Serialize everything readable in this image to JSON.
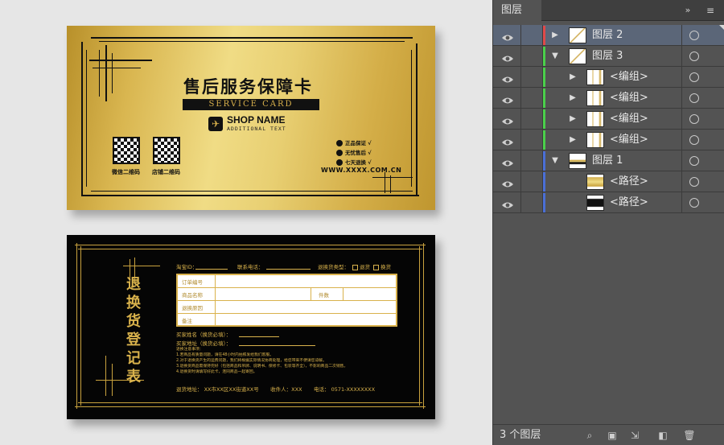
{
  "front_card": {
    "title": "售后服务保障卡",
    "subtitle": "SERVICE CARD",
    "shop_name": "SHOP NAME",
    "shop_sub": "ADDITIONAL TEXT",
    "qr1_label": "微信二维码",
    "qr2_label": "店铺二维码",
    "features": [
      "正品保证",
      "无忧售后",
      "七天退换"
    ],
    "url": "WWW.XXXX.COM.CN"
  },
  "back_card": {
    "vertical_title": "退换货登记表",
    "taobao_id": "淘宝ID：",
    "phone": "联系电话：",
    "return_type": "退换货类型：",
    "opt_return": "退货",
    "opt_exchange": "换货",
    "table_rows": [
      "订单编号",
      "商品名称",
      "退换原因",
      "备注"
    ],
    "table_qty": "件数",
    "buyer_name": "买家姓名（换货必填）：",
    "buyer_address": "买家地址（换货必填）：",
    "notes_title": "退换注意事项：",
    "notes": [
      "1.若商品有质量问题，请在48小时内拍照发给我们客服。",
      "2.对于退换货产生的运费问题，我们将根据实际情况协商处理，给您带来不便请您谅解。",
      "3.退换货商品需保持完好（包括商品和吊牌、说明书、保修卡、包装等齐全），不影响商品二次销售。",
      "4.退换货时请填写好此卡，连同商品一起寄回。"
    ],
    "footer_address": "退货地址：  XX市XX区XX街道XX号",
    "footer_receiver": "收件人：XXX",
    "footer_phone": "电话：  0571-XXXXXXXX"
  },
  "layers_panel": {
    "tab_title": "图层",
    "collapse_icon": "»",
    "menu_icon": "≡",
    "layers": [
      {
        "name": "图层 2",
        "indent": 0,
        "arrow": "▶",
        "color": "#e04a4a",
        "selected": true,
        "thumb": "white-gold"
      },
      {
        "name": "图层 3",
        "indent": 0,
        "arrow": "▼",
        "color": "#4ad04a",
        "selected": false,
        "thumb": "white-gold"
      },
      {
        "name": "<编组>",
        "indent": 1,
        "arrow": "▶",
        "color": "#4ad04a",
        "selected": false,
        "thumb": "gold"
      },
      {
        "name": "<编组>",
        "indent": 1,
        "arrow": "▶",
        "color": "#4ad04a",
        "selected": false,
        "thumb": "gold"
      },
      {
        "name": "<编组>",
        "indent": 1,
        "arrow": "▶",
        "color": "#4ad04a",
        "selected": false,
        "thumb": "gold"
      },
      {
        "name": "<编组>",
        "indent": 1,
        "arrow": "▶",
        "color": "#4ad04a",
        "selected": false,
        "thumb": "gold"
      },
      {
        "name": "图层 1",
        "indent": 0,
        "arrow": "▼",
        "color": "#4a6fd6",
        "selected": false,
        "thumb": "gold-black"
      },
      {
        "name": "<路径>",
        "indent": 1,
        "arrow": "",
        "color": "#4a6fd6",
        "selected": false,
        "thumb": "gold-gradient"
      },
      {
        "name": "<路径>",
        "indent": 1,
        "arrow": "",
        "color": "#4a6fd6",
        "selected": false,
        "thumb": "black"
      }
    ],
    "layer_count": "3 个图层"
  },
  "colors": {
    "gold": "#d9b24c",
    "panel_bg": "#535353",
    "selected_row": "#5b6678"
  }
}
